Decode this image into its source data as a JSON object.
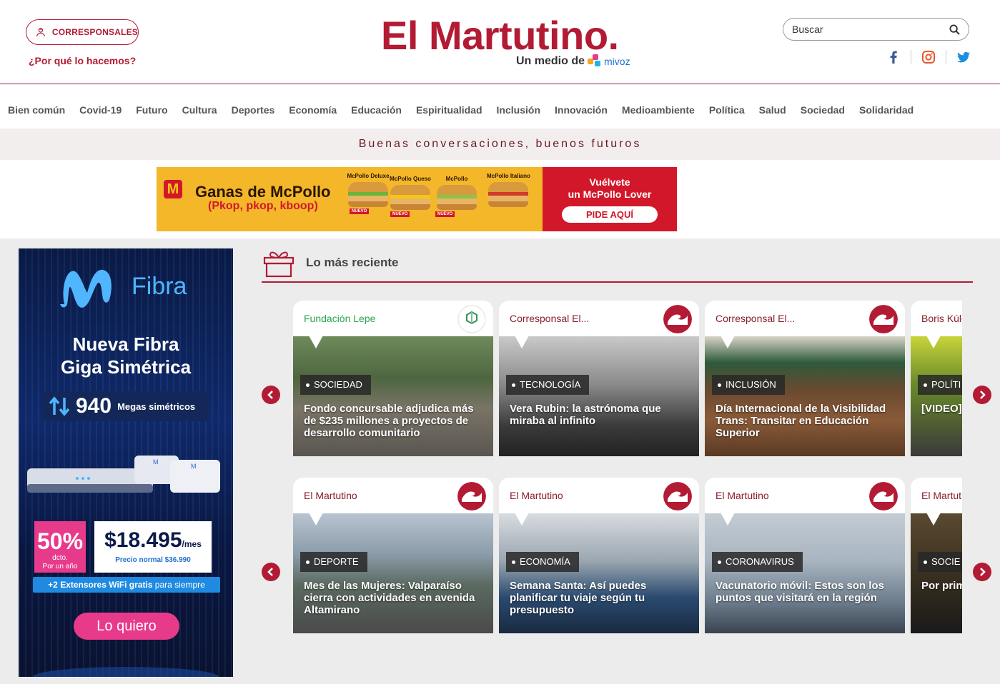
{
  "header": {
    "corresponsales_label": "CORRESPONSALES",
    "why_link": "¿Por qué lo hacemos?",
    "logo": "El Martutino.",
    "sub_logo": "Un medio de",
    "mivoz": "mivoz",
    "search_placeholder": "Buscar",
    "accent_color": "#b31b34"
  },
  "nav": {
    "items": [
      "Bien común",
      "Covid-19",
      "Futuro",
      "Cultura",
      "Deportes",
      "Economía",
      "Educación",
      "Espiritualidad",
      "Inclusión",
      "Innovación",
      "Medioambiente",
      "Política",
      "Salud",
      "Sociedad",
      "Solidaridad"
    ]
  },
  "tagline": "Buenas conversaciones, buenos futuros",
  "top_ad": {
    "headline": "Ganas de McPollo",
    "subhead": "(Pkop, pkop, kboop)",
    "burgers": [
      "McPollo Deluxe",
      "McPollo Queso",
      "McPollo",
      "McPollo Italiano"
    ],
    "nuevo": "NUEVO",
    "cta_line1": "Vuélvete",
    "cta_line2": "un McPollo Lover",
    "cta_button": "PIDE AQUÍ"
  },
  "side_ad": {
    "brand": "Fibra",
    "title_line1": "Nueva Fibra",
    "title_line2": "Giga Simétrica",
    "megas_num": "940",
    "megas_text": "Megas simétricos",
    "discount": "50%",
    "discount_sub1": "dcto.",
    "discount_sub2": "Por un año",
    "price": "$18.495",
    "price_unit": "/mes",
    "normal_price": "Precio normal $36.990",
    "extensores": "+2 Extensores WiFi gratis",
    "extensores_suffix": "para siempre",
    "cta": "Lo quiero"
  },
  "section": {
    "title": "Lo más reciente",
    "row1": [
      {
        "source": "Fundación Lepe",
        "category": "SOCIEDAD",
        "title": "Fondo concursable adjudica más de $235 millones a proyectos de desarrollo comunitario"
      },
      {
        "source": "Corresponsal El...",
        "category": "TECNOLOGÍA",
        "title": "Vera Rubin: la astrónoma que miraba al infinito"
      },
      {
        "source": "Corresponsal El...",
        "category": "INCLUSIÓN",
        "title": "Día Internacional de la Visibilidad Trans: Transitar en Educación Superior"
      },
      {
        "source": "Boris Kúle",
        "category": "POLÍTI",
        "title": "[VIDEO] capítulo del Cone Valparaí"
      }
    ],
    "row2": [
      {
        "source": "El Martutino",
        "category": "DEPORTE",
        "title": "Mes de las Mujeres: Valparaíso cierra con actividades en avenida Altamirano"
      },
      {
        "source": "El Martutino",
        "category": "ECONOMÍA",
        "title": "Semana Santa: Así puedes planificar tu viaje según tu presupuesto"
      },
      {
        "source": "El Martutino",
        "category": "CORONAVIRUS",
        "title": "Vacunatorio móvil: Estos son los puntos que visitará en la región"
      },
      {
        "source": "El Martut",
        "category": "SOCIE",
        "title": "Por prim el cargo en Valpa"
      }
    ]
  }
}
